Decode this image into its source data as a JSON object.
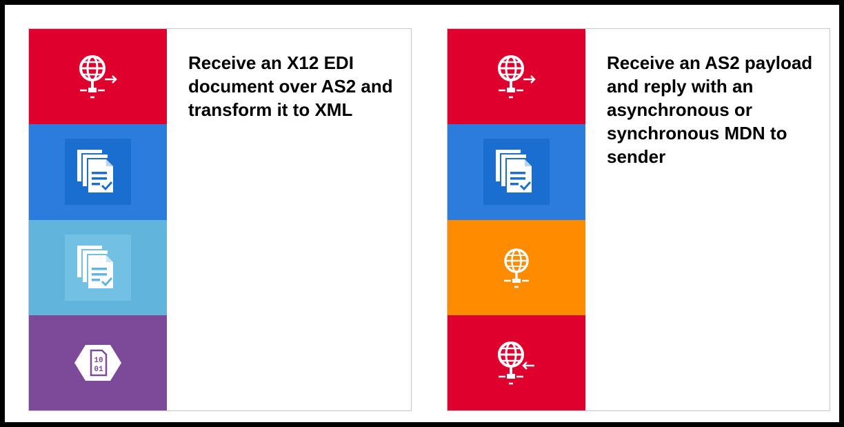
{
  "cards": [
    {
      "title": "Receive an X12 EDI document over AS2 and transform it to XML",
      "tiles": [
        {
          "color": "#e0002e",
          "icon": "globe-send-icon"
        },
        {
          "color": "#2b7cdc",
          "icon": "documents-check-icon"
        },
        {
          "color": "#61b5dc",
          "icon": "documents-check-icon"
        },
        {
          "color": "#7d4a9a",
          "icon": "binary-hexagon-icon",
          "icon_text": "10\n01"
        }
      ]
    },
    {
      "title": "Receive an AS2 payload and reply with an asynchronous or synchronous MDN to sender",
      "tiles": [
        {
          "color": "#e0002e",
          "icon": "globe-send-icon"
        },
        {
          "color": "#2b7cdc",
          "icon": "documents-check-icon"
        },
        {
          "color": "#ff8c00",
          "icon": "globe-network-icon"
        },
        {
          "color": "#e0002e",
          "icon": "globe-receive-icon"
        }
      ]
    }
  ]
}
